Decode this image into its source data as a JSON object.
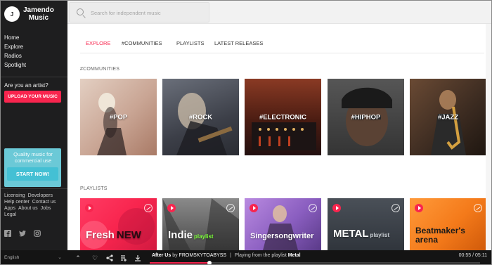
{
  "app": {
    "logo_mark": "J",
    "logo_line1": "Jamendo",
    "logo_line2": "Music"
  },
  "sidebar": {
    "nav": [
      "Home",
      "Explore",
      "Radios",
      "Spotlight"
    ],
    "artist_question": "Are you an artist?",
    "upload_label": "UPLOAD YOUR MUSIC",
    "promo_text": "Quality music for commercial use",
    "promo_button": "START NOW!",
    "links": [
      [
        "Licensing",
        "Developers"
      ],
      [
        "Help center",
        "Contact us"
      ],
      [
        "Apps",
        "About us",
        "Jobs"
      ],
      [
        "Legal"
      ]
    ],
    "social": [
      "facebook-icon",
      "twitter-icon",
      "instagram-icon"
    ],
    "language": "English"
  },
  "search": {
    "placeholder": "Search for independent music"
  },
  "tabs": [
    "EXPLORE",
    "#COMMUNITIES",
    "PLAYLISTS",
    "LATEST RELEASES"
  ],
  "active_tab": "EXPLORE",
  "communities": {
    "title": "#COMMUNITIES",
    "items": [
      {
        "label": "#POP",
        "color": "#d4b9a8"
      },
      {
        "label": "#ROCK",
        "color": "#4a4e58"
      },
      {
        "label": "#ELECTRONIC",
        "color": "#5a2418"
      },
      {
        "label": "#HIPHOP",
        "color": "#3a3a3a"
      },
      {
        "label": "#JAZZ",
        "color": "#3b2a20"
      }
    ]
  },
  "playlists": {
    "title": "PLAYLISTS",
    "items": [
      {
        "name": "Fresh",
        "suffix": "NEW",
        "color": "#f8254e"
      },
      {
        "name": "Indie",
        "suffix": "playlist",
        "color": "#6b6b6b"
      },
      {
        "name": "Singersongwriter",
        "suffix": "",
        "color": "#8a5ec0"
      },
      {
        "name": "METAL",
        "suffix": "playlist",
        "color": "#3a4048"
      },
      {
        "name": "Beatmaker's arena",
        "suffix": "",
        "color": "#f47a1a"
      }
    ]
  },
  "player": {
    "track": "After Us",
    "by": "by",
    "artist": "FROMSKYTOABYSS",
    "separator": "|",
    "playing_from": "Playing from the playlist",
    "playlist": "Metal",
    "time": "00:55 / 05:11",
    "progress": 0.18
  }
}
